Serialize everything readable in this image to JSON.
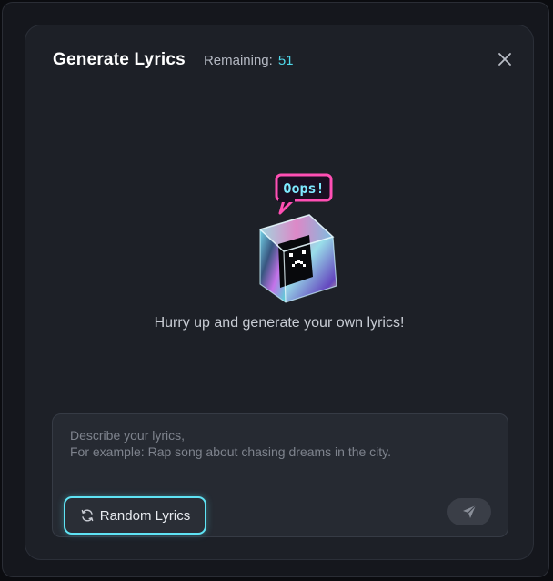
{
  "dialog": {
    "title": "Generate Lyrics",
    "remaining_label": "Remaining:",
    "remaining_count": "51",
    "close_icon": "close-icon"
  },
  "illustration": {
    "badge_text": "Oops!",
    "icon": "sad-cube-illustration"
  },
  "message": "Hurry up and generate your own lyrics!",
  "composer": {
    "placeholder": "Describe your lyrics,\nFor example: Rap song about chasing dreams in the city.",
    "value": "",
    "random_button_label": "Random Lyrics",
    "random_icon": "refresh-icon",
    "send_icon": "send-icon"
  },
  "colors": {
    "accent": "#4fd8ea",
    "badge_pink": "#ff4fb4",
    "dialog_bg": "#1d2027"
  }
}
